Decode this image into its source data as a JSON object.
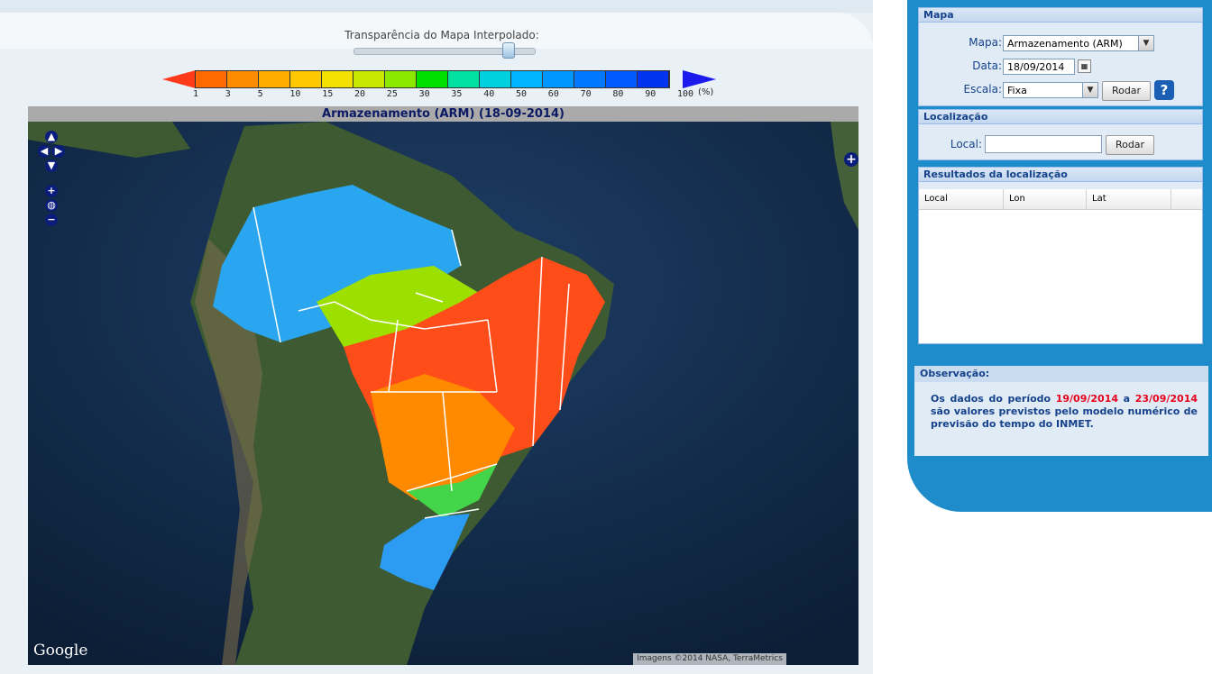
{
  "main": {
    "slider_label": "Transparência do Mapa Interpolado:",
    "map_title": "Armazenamento (ARM) (18-09-2014)",
    "google": "Google",
    "attribution": "Imagens ©2014 NASA, TerraMetrics",
    "legend": {
      "ticks": [
        "1",
        "3",
        "5",
        "10",
        "15",
        "20",
        "25",
        "30",
        "35",
        "40",
        "50",
        "60",
        "70",
        "80",
        "90",
        "100"
      ],
      "unit": "(%)",
      "colors": [
        "#ff6a00",
        "#ff8c00",
        "#ffae00",
        "#ffc800",
        "#f2e000",
        "#c8e800",
        "#8ce800",
        "#00e000",
        "#00e0a0",
        "#00d0e0",
        "#00b4ff",
        "#0096ff",
        "#0078ff",
        "#005aff",
        "#0034f0"
      ]
    },
    "nav_icons": [
      "pan-up-icon",
      "pan-left-icon",
      "pan-right-icon",
      "pan-down-icon",
      "zoom-in-icon",
      "world-icon",
      "zoom-out-icon"
    ]
  },
  "sidebar": {
    "mapa": {
      "title": "Mapa",
      "mapa_label": "Mapa:",
      "mapa_value": "Armazenamento (ARM)",
      "data_label": "Data:",
      "data_value": "18/09/2014",
      "escala_label": "Escala:",
      "escala_value": "Fixa",
      "rodar": "Rodar",
      "help": "?"
    },
    "localizacao": {
      "title": "Localização",
      "local_label": "Local:",
      "local_value": "",
      "rodar": "Rodar"
    },
    "resultados": {
      "title": "Resultados da localização",
      "columns": [
        "Local",
        "Lon",
        "Lat"
      ]
    },
    "observacao": {
      "title": "Observação:",
      "text_before": "Os dados do período ",
      "date_start": "19/09/2014",
      "middle": " a ",
      "date_end": "23/09/2014",
      "text_after": " são valores previstos pelo modelo numérico de previsão do tempo do INMET."
    }
  }
}
